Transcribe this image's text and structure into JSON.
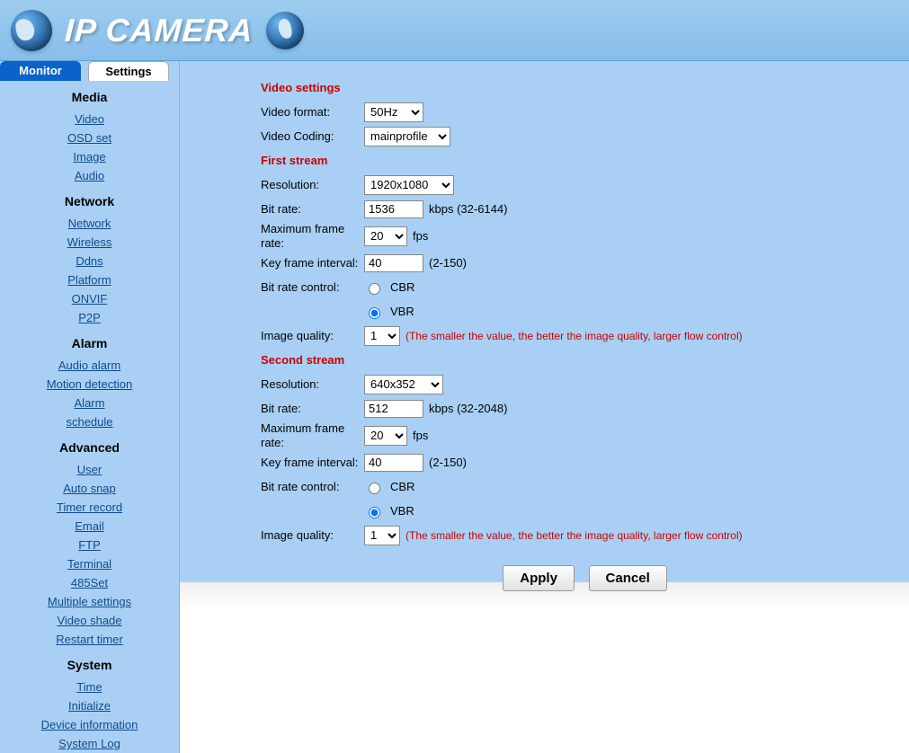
{
  "header": {
    "title": "IP CAMERA"
  },
  "tabs": {
    "monitor": "Monitor",
    "settings": "Settings"
  },
  "sidebar": {
    "media": {
      "title": "Media",
      "items": [
        {
          "label": "Video"
        },
        {
          "label": "OSD set"
        },
        {
          "label": "Image"
        },
        {
          "label": "Audio"
        }
      ]
    },
    "network": {
      "title": "Network",
      "items": [
        {
          "label": "Network"
        },
        {
          "label": "Wireless"
        },
        {
          "label": "Ddns"
        },
        {
          "label": "Platform"
        },
        {
          "label": "ONVIF"
        },
        {
          "label": "P2P"
        }
      ]
    },
    "alarm": {
      "title": "Alarm",
      "items": [
        {
          "label": "Audio alarm"
        },
        {
          "label": "Motion detection"
        },
        {
          "label": "Alarm"
        },
        {
          "label": "schedule"
        }
      ]
    },
    "advanced": {
      "title": "Advanced",
      "items": [
        {
          "label": "User"
        },
        {
          "label": "Auto snap"
        },
        {
          "label": "Timer record"
        },
        {
          "label": "Email"
        },
        {
          "label": "FTP"
        },
        {
          "label": "Terminal"
        },
        {
          "label": "485Set"
        },
        {
          "label": "Multiple settings"
        },
        {
          "label": "Video shade"
        },
        {
          "label": "Restart timer"
        }
      ]
    },
    "system": {
      "title": "System",
      "items": [
        {
          "label": "Time"
        },
        {
          "label": "Initialize"
        },
        {
          "label": "Device information"
        },
        {
          "label": "System Log"
        }
      ]
    }
  },
  "form": {
    "video_settings_header": "Video settings",
    "video_format_label": "Video format:",
    "video_format_value": "50Hz",
    "video_coding_label": "Video Coding:",
    "video_coding_value": "mainprofile",
    "first_stream_header": "First stream",
    "second_stream_header": "Second stream",
    "resolution_label": "Resolution:",
    "bitrate_label": "Bit rate:",
    "max_frame_label": "Maximum frame rate:",
    "key_frame_label": "Key frame interval:",
    "bitrate_control_label": "Bit rate control:",
    "image_quality_label": "Image quality:",
    "first": {
      "resolution_value": "1920x1080",
      "bitrate_value": "1536",
      "bitrate_unit": "kbps (32-6144)",
      "max_frame_value": "20",
      "fps_unit": "fps",
      "key_frame_value": "40",
      "key_frame_hint": "(2-150)",
      "cbr_label": "CBR",
      "vbr_label": "VBR",
      "brc_selected": "VBR",
      "iq_value": "1",
      "iq_hint": "(The smaller the value, the better the image quality, larger flow control)"
    },
    "second": {
      "resolution_value": "640x352",
      "bitrate_value": "512",
      "bitrate_unit": "kbps (32-2048)",
      "max_frame_value": "20",
      "fps_unit": "fps",
      "key_frame_value": "40",
      "key_frame_hint": "(2-150)",
      "cbr_label": "CBR",
      "vbr_label": "VBR",
      "brc_selected": "VBR",
      "iq_value": "1",
      "iq_hint": "(The smaller the value, the better the image quality, larger flow control)"
    },
    "buttons": {
      "apply": "Apply",
      "cancel": "Cancel"
    }
  }
}
